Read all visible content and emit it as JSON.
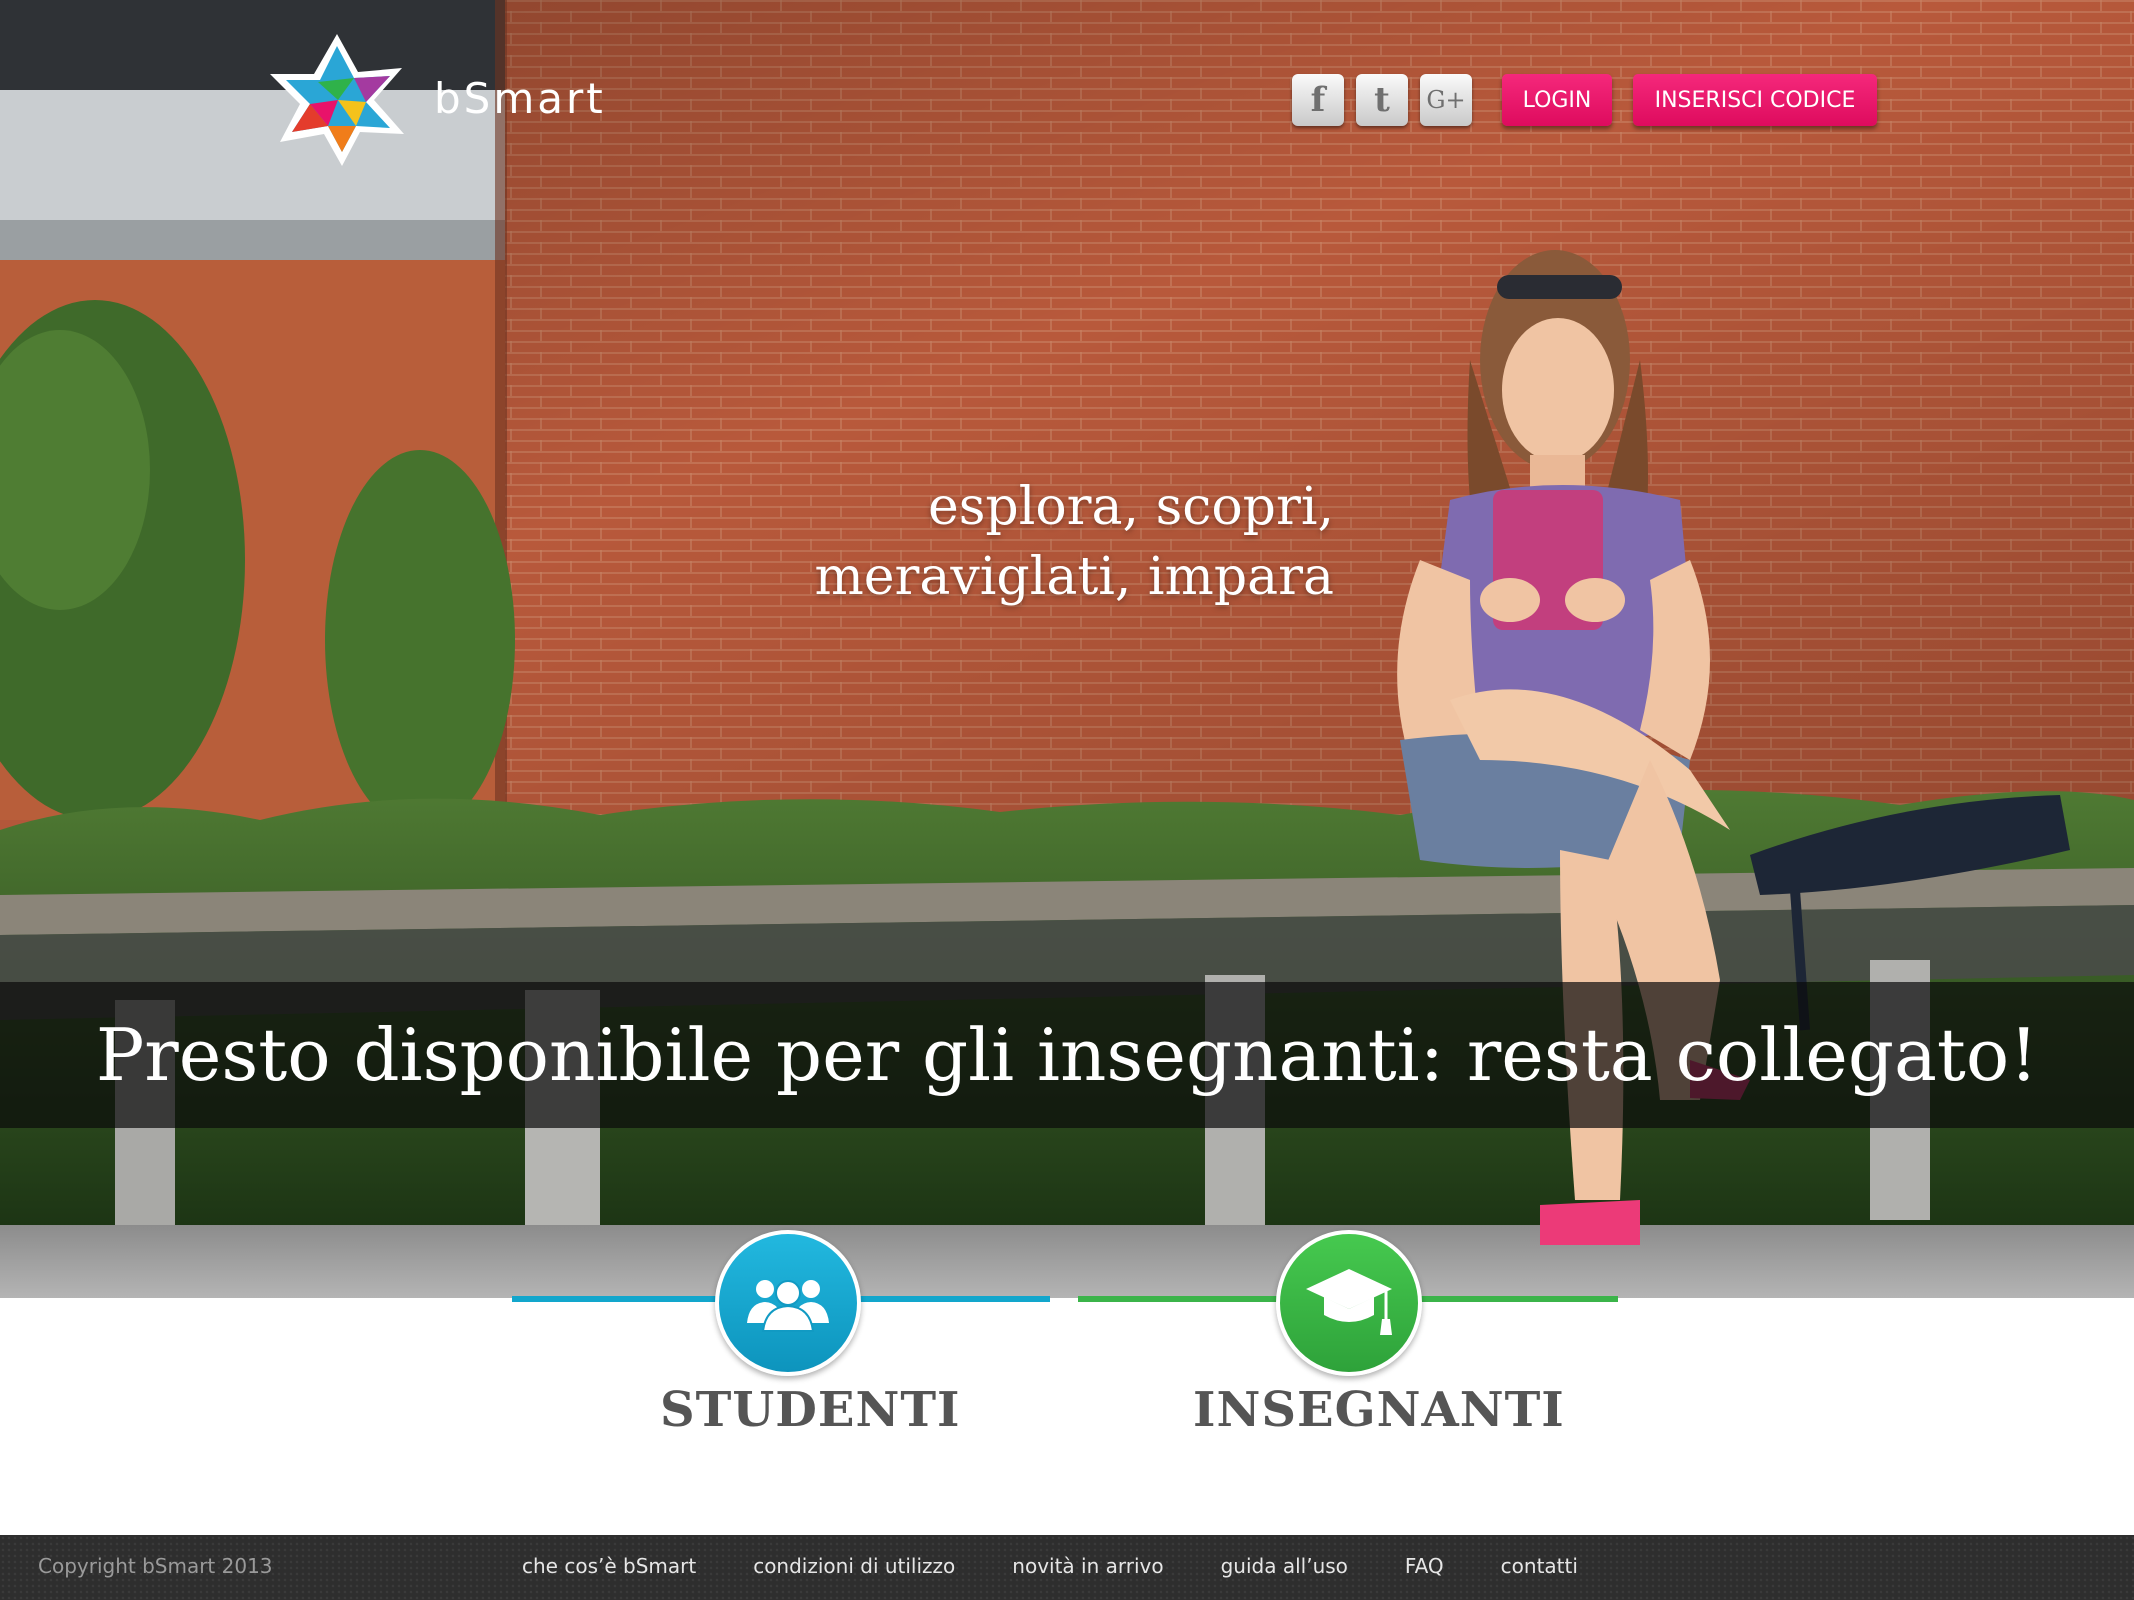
{
  "brand": {
    "name": "bSmart"
  },
  "social": [
    {
      "name": "facebook",
      "glyph": "f"
    },
    {
      "name": "twitter",
      "glyph": "t"
    },
    {
      "name": "google-plus",
      "glyph": "G+"
    }
  ],
  "header": {
    "login_label": "LOGIN",
    "code_label": "INSERISCI CODICE"
  },
  "hero": {
    "tagline_line1": "esplora, scopri,",
    "tagline_line2": "meraviglati, impara",
    "banner": "Presto disponibile per gli insegnanti: resta collegato!"
  },
  "roles": {
    "students_label": "STUDENTI",
    "teachers_label": "INSEGNANTI",
    "students_icon": "group-icon",
    "teachers_icon": "graduation-cap-icon"
  },
  "footer": {
    "copyright": "Copyright bSmart 2013",
    "links": [
      "che cos’è bSmart",
      "condizioni di utilizzo",
      "novità in arrivo",
      "guida all’uso",
      "FAQ",
      "contatti"
    ]
  },
  "colors": {
    "accent_pink": "#e8126a",
    "students_blue": "#12a6cc",
    "teachers_green": "#3bb44a",
    "footer_bg": "#2e2e2e"
  }
}
